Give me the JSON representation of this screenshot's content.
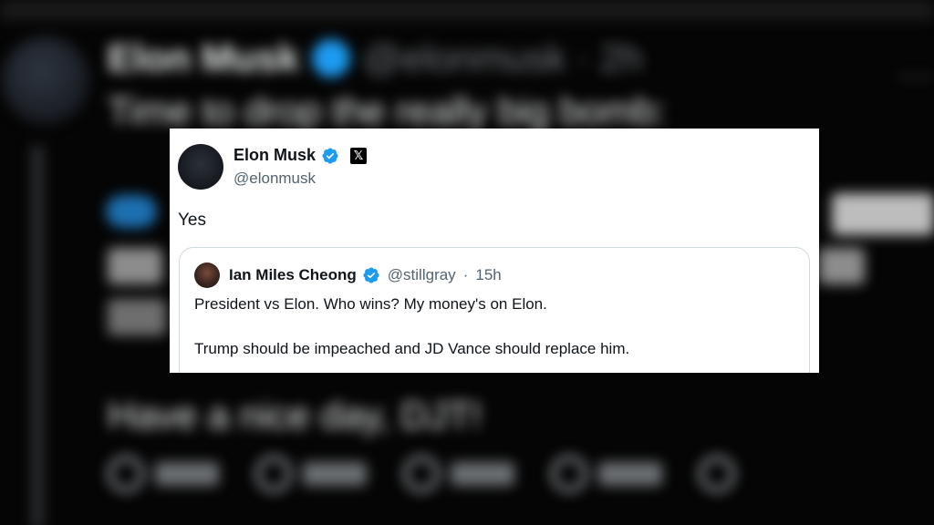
{
  "background_tweet": {
    "author_name": "Elon Musk",
    "handle_time": "@elonmusk · 2h",
    "line1": "Time to drop the really big bomb:",
    "line2": "Have a nice day, DJT!",
    "dots": "···"
  },
  "tweet": {
    "author_name": "Elon Musk",
    "author_handle": "@elonmusk",
    "text": "Yes",
    "x_logo": "𝕏",
    "icons": {
      "verified": "verified-badge-icon",
      "platform": "x-logo-icon"
    },
    "colors": {
      "verified": "#1d9bf0",
      "secondary_text": "#536471",
      "primary_text": "#0f1419"
    }
  },
  "quoted_tweet": {
    "author_name": "Ian Miles Cheong",
    "handle": "@stillgray",
    "separator": "·",
    "time": "15h",
    "line1": "President vs Elon. Who wins? My money's on Elon.",
    "line2": "Trump should be impeached and JD Vance should replace him."
  }
}
